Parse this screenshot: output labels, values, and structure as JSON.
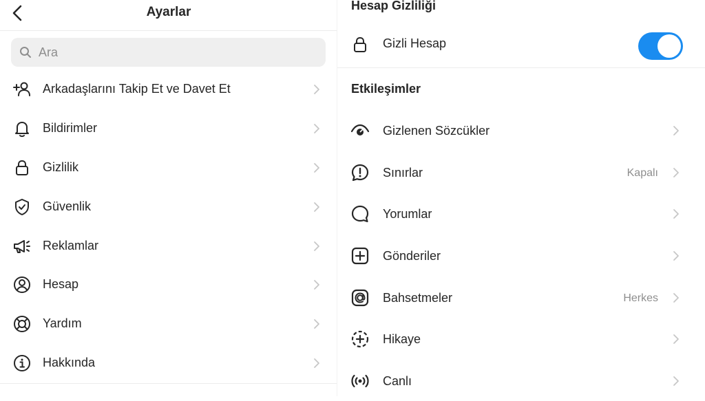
{
  "left": {
    "title": "Ayarlar",
    "search_placeholder": "Ara",
    "items": [
      {
        "label": "Arkadaşlarını Takip Et ve Davet Et",
        "icon": "add-person-icon"
      },
      {
        "label": "Bildirimler",
        "icon": "bell-icon"
      },
      {
        "label": "Gizlilik",
        "icon": "lock-icon"
      },
      {
        "label": "Güvenlik",
        "icon": "shield-check-icon"
      },
      {
        "label": "Reklamlar",
        "icon": "megaphone-icon"
      },
      {
        "label": "Hesap",
        "icon": "account-circle-icon"
      },
      {
        "label": "Yardım",
        "icon": "lifebuoy-icon"
      },
      {
        "label": "Hakkında",
        "icon": "info-icon"
      }
    ]
  },
  "right": {
    "section_privacy": "Hesap Gizliliği",
    "private_account": {
      "label": "Gizli Hesap",
      "icon": "lock-icon",
      "enabled": true
    },
    "section_interactions": "Etkileşimler",
    "items": [
      {
        "label": "Gizlenen Sözcükler",
        "value": "",
        "icon": "hidden-eye-icon"
      },
      {
        "label": "Sınırlar",
        "value": "Kapalı",
        "icon": "limits-alert-icon"
      },
      {
        "label": "Yorumlar",
        "value": "",
        "icon": "comment-icon"
      },
      {
        "label": "Gönderiler",
        "value": "",
        "icon": "add-square-icon"
      },
      {
        "label": "Bahsetmeler",
        "value": "Herkes",
        "icon": "at-icon"
      },
      {
        "label": "Hikaye",
        "value": "",
        "icon": "story-add-icon"
      },
      {
        "label": "Canlı",
        "value": "",
        "icon": "live-icon"
      }
    ]
  },
  "colors": {
    "toggle_on": "#1a8cf0",
    "text": "#262626",
    "muted": "#8e8e8e"
  }
}
